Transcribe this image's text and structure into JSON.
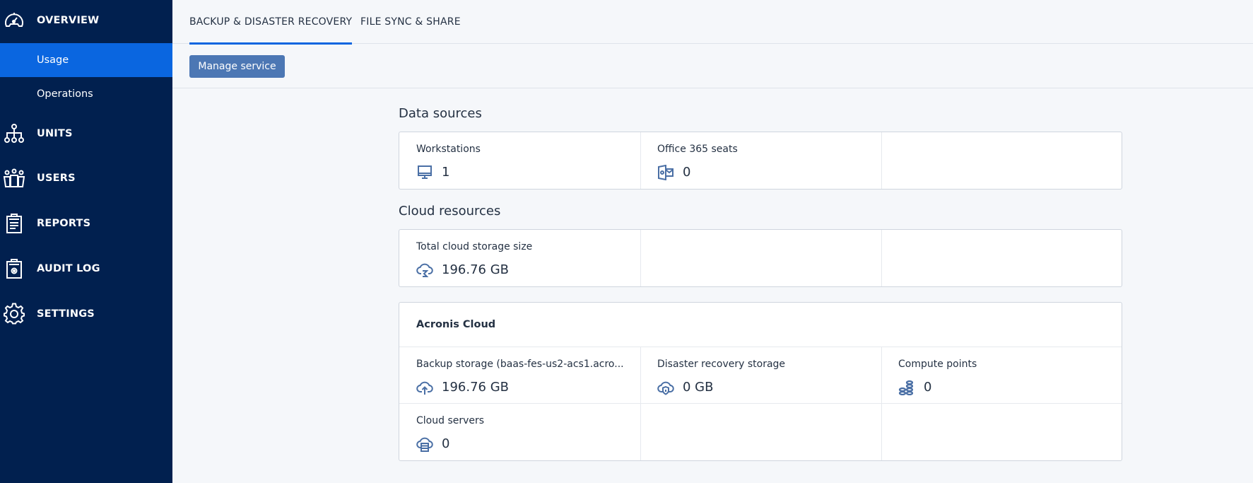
{
  "sidebar": {
    "items": [
      {
        "label": "OVERVIEW",
        "icon": "dashboard-gauge-icon"
      },
      {
        "label": "UNITS",
        "icon": "org-hierarchy-icon"
      },
      {
        "label": "USERS",
        "icon": "users-group-icon"
      },
      {
        "label": "REPORTS",
        "icon": "clipboard-report-icon"
      },
      {
        "label": "AUDIT LOG",
        "icon": "clipboard-gear-icon"
      },
      {
        "label": "SETTINGS",
        "icon": "gear-icon"
      }
    ],
    "overview_sub": [
      {
        "label": "Usage",
        "active": true
      },
      {
        "label": "Operations",
        "active": false
      }
    ]
  },
  "tabs": [
    {
      "label": "BACKUP & DISASTER RECOVERY",
      "active": true
    },
    {
      "label": "FILE SYNC & SHARE",
      "active": false
    }
  ],
  "toolbar": {
    "manage_label": "Manage service"
  },
  "data_sources": {
    "title": "Data sources",
    "items": [
      {
        "label": "Workstations",
        "value": "1",
        "icon": "monitor-icon"
      },
      {
        "label": "Office 365 seats",
        "value": "0",
        "icon": "outlook-icon"
      }
    ]
  },
  "cloud_resources": {
    "title": "Cloud resources",
    "items": [
      {
        "label": "Total cloud storage size",
        "value": "196.76 GB",
        "icon": "cloud-storage-icon"
      }
    ]
  },
  "acronis_cloud": {
    "title": "Acronis Cloud",
    "items": [
      {
        "label": "Backup storage (baas-fes-us2-acs1.acro...",
        "value": "196.76 GB",
        "icon": "cloud-upload-icon"
      },
      {
        "label": "Disaster recovery storage",
        "value": "0 GB",
        "icon": "cloud-shield-icon"
      },
      {
        "label": "Compute points",
        "value": "0",
        "icon": "coins-stack-icon"
      },
      {
        "label": "Cloud servers",
        "value": "0",
        "icon": "cloud-server-icon"
      }
    ]
  },
  "colors": {
    "sidebar_bg": "#01204f",
    "accent": "#0a66e0",
    "button": "#4c77b4",
    "icon": "#4a6fa5"
  }
}
